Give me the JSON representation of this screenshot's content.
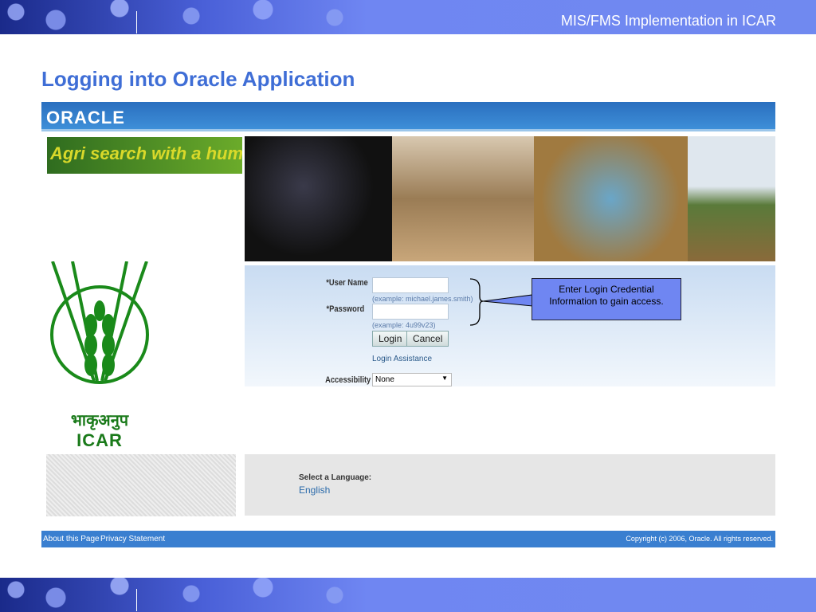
{
  "slide": {
    "header": "MIS/FMS Implementation in ICAR",
    "title": "Logging into Oracle Application"
  },
  "oracle": {
    "logo": "ORACLE",
    "banner": "Agri search with a human touch",
    "logo_text": {
      "hindi": "भाकृअनुप",
      "english": "ICAR"
    },
    "form": {
      "username_label": "*User Name",
      "username_value": "",
      "username_hint": "(example: michael.james.smith)",
      "password_label": "*Password",
      "password_value": "",
      "password_hint": "(example: 4u99v23)",
      "login_button": "Login",
      "cancel_button": "Cancel",
      "login_assistance": "Login Assistance",
      "accessibility_label": "Accessibility",
      "accessibility_value": "None"
    },
    "language": {
      "label": "Select a Language:",
      "option": "English"
    },
    "footer": {
      "about": "About this Page",
      "privacy": "Privacy Statement",
      "copyright": "Copyright (c) 2006, Oracle. All rights reserved."
    }
  },
  "callout": {
    "text": "Enter Login Credential Information to gain access.",
    "color": "#6f86f2"
  },
  "colors": {
    "title": "#3f6ed6",
    "band": "#7089f0",
    "oracle_bar": "#3a7fd0"
  }
}
